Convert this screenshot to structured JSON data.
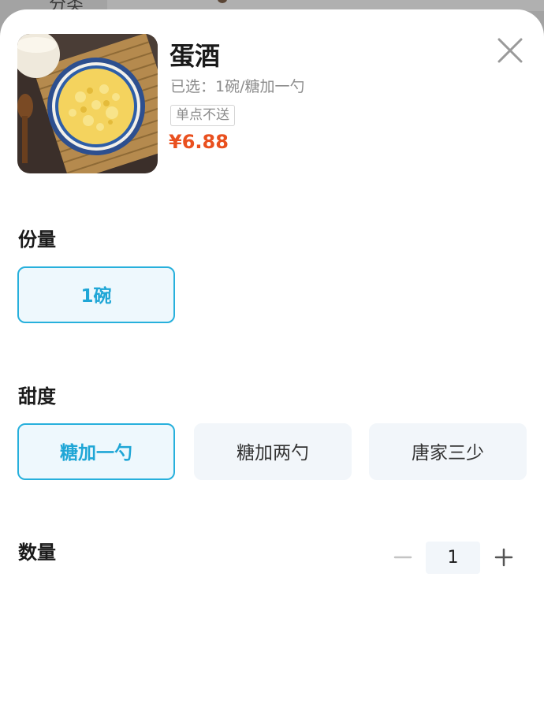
{
  "background": {
    "partial_label": "分类"
  },
  "product": {
    "image_icon": "egg-drop-soup-photo",
    "name": "蛋酒",
    "selected_text": "已选：1碗/糖加一勺",
    "badge": "单点不送",
    "price": "¥6.88",
    "price_color": "#e9501f"
  },
  "close_icon": "close-icon",
  "options": {
    "portion": {
      "label": "份量",
      "items": [
        {
          "label": "1碗",
          "selected": true
        }
      ]
    },
    "sweetness": {
      "label": "甜度",
      "items": [
        {
          "label": "糖加一勺",
          "selected": true
        },
        {
          "label": "糖加两勺",
          "selected": false
        },
        {
          "label": "唐家三少",
          "selected": false
        }
      ]
    }
  },
  "quantity": {
    "label": "数量",
    "value": "1",
    "minus_icon": "minus-icon",
    "plus_icon": "plus-icon"
  },
  "colors": {
    "accent": "#27b0dc",
    "selected_bg": "#eef8fd",
    "option_bg": "#f2f6fa"
  }
}
